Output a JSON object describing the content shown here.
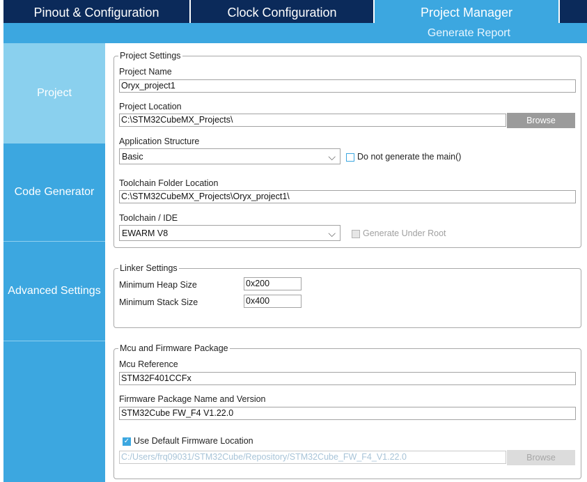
{
  "tabs": [
    {
      "label": "Pinout & Configuration"
    },
    {
      "label": "Clock Configuration"
    },
    {
      "label": "Project Manager"
    }
  ],
  "subbar": {
    "generate_report": "Generate Report"
  },
  "sidebar": {
    "items": [
      {
        "label": "Project"
      },
      {
        "label": "Code Generator"
      },
      {
        "label": "Advanced Settings"
      }
    ]
  },
  "project_settings": {
    "legend": "Project Settings",
    "project_name_label": "Project Name",
    "project_name_value": "Oryx_project1",
    "project_location_label": "Project Location",
    "project_location_value": "C:\\STM32CubeMX_Projects\\",
    "browse_label": "Browse",
    "app_structure_label": "Application Structure",
    "app_structure_value": "Basic",
    "do_not_generate_main_label": "Do not generate the main()",
    "do_not_generate_main_checked": false,
    "toolchain_folder_label": "Toolchain Folder Location",
    "toolchain_folder_value": "C:\\STM32CubeMX_Projects\\Oryx_project1\\",
    "toolchain_ide_label": "Toolchain / IDE",
    "toolchain_ide_value": "EWARM V8",
    "generate_under_root_label": "Generate Under Root",
    "generate_under_root_enabled": false
  },
  "linker_settings": {
    "legend": "Linker Settings",
    "min_heap_label": "Minimum Heap Size",
    "min_heap_value": "0x200",
    "min_stack_label": "Minimum Stack Size",
    "min_stack_value": "0x400"
  },
  "mcu_firmware": {
    "legend": "Mcu and Firmware Package",
    "mcu_reference_label": "Mcu Reference",
    "mcu_reference_value": "STM32F401CCFx",
    "fw_package_label": "Firmware Package Name and Version",
    "fw_package_value": "STM32Cube FW_F4 V1.22.0",
    "use_default_location_label": "Use Default Firmware Location",
    "use_default_location_checked": true,
    "fw_location_value": "C:/Users/frq09031/STM32Cube/Repository/STM32Cube_FW_F4_V1.22.0",
    "browse_label": "Browse"
  },
  "colors": {
    "tab_dark": "#0b2a5a",
    "accent": "#3ca7e0",
    "sidebar_active": "#8ad0ee"
  }
}
